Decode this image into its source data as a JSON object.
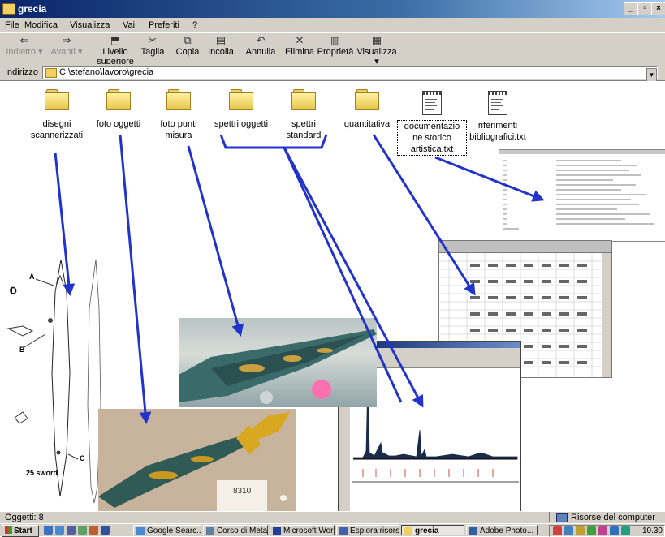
{
  "window": {
    "title": "grecia"
  },
  "menu": [
    "File",
    "Modifica",
    "Visualizza",
    "Vai",
    "Preferiti",
    "?"
  ],
  "toolbar": {
    "back": "Indietro",
    "forward": "Avanti",
    "up_line1": "Livello",
    "up_line2": "superiore",
    "cut": "Taglia",
    "copy": "Copia",
    "paste": "Incolla",
    "undo": "Annulla",
    "delete": "Elimina",
    "properties": "Proprietà",
    "views": "Visualizza"
  },
  "address": {
    "label": "Indirizzo",
    "path": "C:\\stefano\\lavoro\\grecia"
  },
  "items": [
    {
      "line1": "disegni",
      "line2": "scannerizzati",
      "line3": "",
      "icon": "folder-icon"
    },
    {
      "line1": "foto oggetti",
      "line2": "",
      "line3": "",
      "icon": "folder-icon"
    },
    {
      "line1": "foto punti",
      "line2": "misura",
      "line3": "",
      "icon": "folder-icon"
    },
    {
      "line1": "spettri oggetti",
      "line2": "",
      "line3": "",
      "icon": "folder-icon"
    },
    {
      "line1": "spettri",
      "line2": "standard",
      "line3": "",
      "icon": "folder-icon"
    },
    {
      "line1": "quantitativa",
      "line2": "",
      "line3": "",
      "icon": "folder-icon"
    },
    {
      "line1": "documentazio",
      "line2": "ne storico",
      "line3": "artistica.txt",
      "icon": "text-file-icon"
    },
    {
      "line1": "riferimenti",
      "line2": "bibliografici.txt",
      "line3": "",
      "icon": "text-file-icon"
    }
  ],
  "overlays": {
    "drawing_labels": {
      "a": "A",
      "b": "B",
      "c": "C",
      "d": "D",
      "caption": "25 sword"
    },
    "photo_tag": "8310"
  },
  "status": {
    "objects": "Oggetti: 8",
    "location": "Risorse del computer"
  },
  "taskbar": {
    "start": "Start",
    "tasks": [
      "Google Searc...",
      "Corso di Meta...",
      "Microsoft Wor...",
      "Esplora risors...",
      "grecia",
      "Adobe Photo..."
    ],
    "clock": "10.30"
  },
  "colors": {
    "arrow": "#2233cc",
    "titlebar": "#0a246a",
    "chrome": "#d4d0c8"
  }
}
